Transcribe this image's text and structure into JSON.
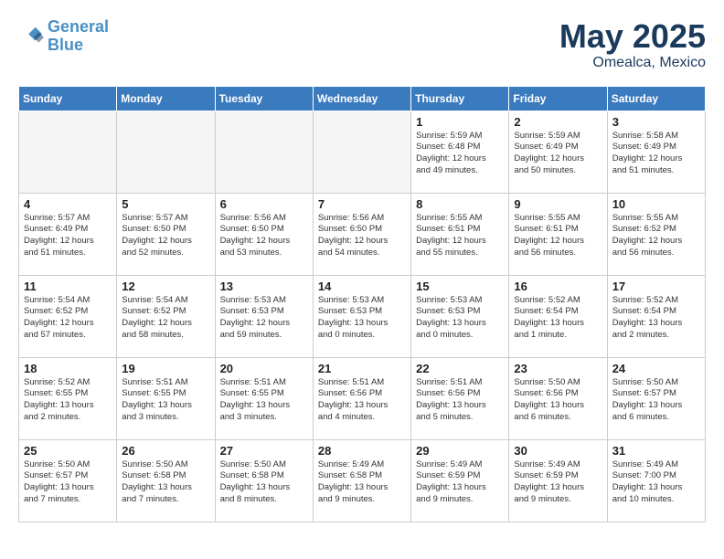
{
  "header": {
    "logo_line1": "General",
    "logo_line2": "Blue",
    "month": "May 2025",
    "location": "Omealca, Mexico"
  },
  "days_of_week": [
    "Sunday",
    "Monday",
    "Tuesday",
    "Wednesday",
    "Thursday",
    "Friday",
    "Saturday"
  ],
  "weeks": [
    [
      {
        "day": "",
        "info": ""
      },
      {
        "day": "",
        "info": ""
      },
      {
        "day": "",
        "info": ""
      },
      {
        "day": "",
        "info": ""
      },
      {
        "day": "1",
        "info": "Sunrise: 5:59 AM\nSunset: 6:48 PM\nDaylight: 12 hours\nand 49 minutes."
      },
      {
        "day": "2",
        "info": "Sunrise: 5:59 AM\nSunset: 6:49 PM\nDaylight: 12 hours\nand 50 minutes."
      },
      {
        "day": "3",
        "info": "Sunrise: 5:58 AM\nSunset: 6:49 PM\nDaylight: 12 hours\nand 51 minutes."
      }
    ],
    [
      {
        "day": "4",
        "info": "Sunrise: 5:57 AM\nSunset: 6:49 PM\nDaylight: 12 hours\nand 51 minutes."
      },
      {
        "day": "5",
        "info": "Sunrise: 5:57 AM\nSunset: 6:50 PM\nDaylight: 12 hours\nand 52 minutes."
      },
      {
        "day": "6",
        "info": "Sunrise: 5:56 AM\nSunset: 6:50 PM\nDaylight: 12 hours\nand 53 minutes."
      },
      {
        "day": "7",
        "info": "Sunrise: 5:56 AM\nSunset: 6:50 PM\nDaylight: 12 hours\nand 54 minutes."
      },
      {
        "day": "8",
        "info": "Sunrise: 5:55 AM\nSunset: 6:51 PM\nDaylight: 12 hours\nand 55 minutes."
      },
      {
        "day": "9",
        "info": "Sunrise: 5:55 AM\nSunset: 6:51 PM\nDaylight: 12 hours\nand 56 minutes."
      },
      {
        "day": "10",
        "info": "Sunrise: 5:55 AM\nSunset: 6:52 PM\nDaylight: 12 hours\nand 56 minutes."
      }
    ],
    [
      {
        "day": "11",
        "info": "Sunrise: 5:54 AM\nSunset: 6:52 PM\nDaylight: 12 hours\nand 57 minutes."
      },
      {
        "day": "12",
        "info": "Sunrise: 5:54 AM\nSunset: 6:52 PM\nDaylight: 12 hours\nand 58 minutes."
      },
      {
        "day": "13",
        "info": "Sunrise: 5:53 AM\nSunset: 6:53 PM\nDaylight: 12 hours\nand 59 minutes."
      },
      {
        "day": "14",
        "info": "Sunrise: 5:53 AM\nSunset: 6:53 PM\nDaylight: 13 hours\nand 0 minutes."
      },
      {
        "day": "15",
        "info": "Sunrise: 5:53 AM\nSunset: 6:53 PM\nDaylight: 13 hours\nand 0 minutes."
      },
      {
        "day": "16",
        "info": "Sunrise: 5:52 AM\nSunset: 6:54 PM\nDaylight: 13 hours\nand 1 minute."
      },
      {
        "day": "17",
        "info": "Sunrise: 5:52 AM\nSunset: 6:54 PM\nDaylight: 13 hours\nand 2 minutes."
      }
    ],
    [
      {
        "day": "18",
        "info": "Sunrise: 5:52 AM\nSunset: 6:55 PM\nDaylight: 13 hours\nand 2 minutes."
      },
      {
        "day": "19",
        "info": "Sunrise: 5:51 AM\nSunset: 6:55 PM\nDaylight: 13 hours\nand 3 minutes."
      },
      {
        "day": "20",
        "info": "Sunrise: 5:51 AM\nSunset: 6:55 PM\nDaylight: 13 hours\nand 3 minutes."
      },
      {
        "day": "21",
        "info": "Sunrise: 5:51 AM\nSunset: 6:56 PM\nDaylight: 13 hours\nand 4 minutes."
      },
      {
        "day": "22",
        "info": "Sunrise: 5:51 AM\nSunset: 6:56 PM\nDaylight: 13 hours\nand 5 minutes."
      },
      {
        "day": "23",
        "info": "Sunrise: 5:50 AM\nSunset: 6:56 PM\nDaylight: 13 hours\nand 6 minutes."
      },
      {
        "day": "24",
        "info": "Sunrise: 5:50 AM\nSunset: 6:57 PM\nDaylight: 13 hours\nand 6 minutes."
      }
    ],
    [
      {
        "day": "25",
        "info": "Sunrise: 5:50 AM\nSunset: 6:57 PM\nDaylight: 13 hours\nand 7 minutes."
      },
      {
        "day": "26",
        "info": "Sunrise: 5:50 AM\nSunset: 6:58 PM\nDaylight: 13 hours\nand 7 minutes."
      },
      {
        "day": "27",
        "info": "Sunrise: 5:50 AM\nSunset: 6:58 PM\nDaylight: 13 hours\nand 8 minutes."
      },
      {
        "day": "28",
        "info": "Sunrise: 5:49 AM\nSunset: 6:58 PM\nDaylight: 13 hours\nand 9 minutes."
      },
      {
        "day": "29",
        "info": "Sunrise: 5:49 AM\nSunset: 6:59 PM\nDaylight: 13 hours\nand 9 minutes."
      },
      {
        "day": "30",
        "info": "Sunrise: 5:49 AM\nSunset: 6:59 PM\nDaylight: 13 hours\nand 9 minutes."
      },
      {
        "day": "31",
        "info": "Sunrise: 5:49 AM\nSunset: 7:00 PM\nDaylight: 13 hours\nand 10 minutes."
      }
    ]
  ]
}
